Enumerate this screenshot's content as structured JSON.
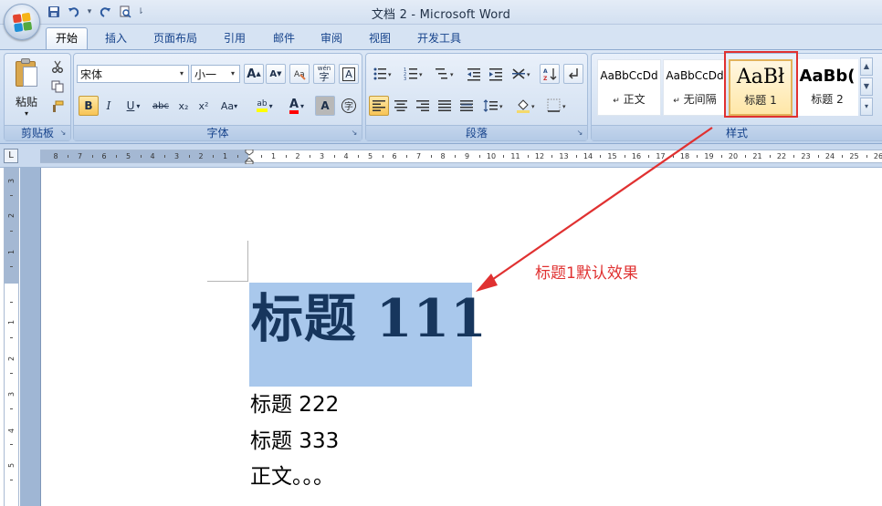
{
  "window": {
    "title": "文档 2 - Microsoft Word"
  },
  "quick_access": {
    "items": [
      "save-icon",
      "undo-icon",
      "redo-icon",
      "print-preview-icon",
      "customize-icon"
    ]
  },
  "tabs": [
    {
      "label": "开始",
      "active": true
    },
    {
      "label": "插入"
    },
    {
      "label": "页面布局"
    },
    {
      "label": "引用"
    },
    {
      "label": "邮件"
    },
    {
      "label": "审阅"
    },
    {
      "label": "视图"
    },
    {
      "label": "开发工具"
    }
  ],
  "ribbon": {
    "clipboard": {
      "label": "剪贴板",
      "paste_label": "粘贴"
    },
    "font": {
      "label": "字体",
      "font_name": "宋体",
      "font_size": "小一",
      "grow": "A",
      "shrink": "A",
      "bold": "B",
      "italic": "I",
      "underline": "U",
      "strike": "abc",
      "subscript": "x₂",
      "superscript": "x²",
      "case": "Aa",
      "highlight": "ab",
      "font_color": "A",
      "char_shade": "A",
      "enclose": "字",
      "wen": "wén",
      "char_border": "A"
    },
    "paragraph": {
      "label": "段落"
    },
    "styles": {
      "label": "样式",
      "items": [
        {
          "sample": "AaBbCcDd",
          "name": "正文",
          "mark": "↵"
        },
        {
          "sample": "AaBbCcDd",
          "name": "无间隔",
          "mark": "↵"
        },
        {
          "sample": "AaBł",
          "name": "标题 1",
          "selected": true
        },
        {
          "sample": "AaBb(",
          "name": "标题 2"
        }
      ]
    }
  },
  "ruler": {
    "numbers_left": [
      "8",
      "7",
      "6",
      "5",
      "4",
      "3",
      "2",
      "1"
    ],
    "numbers_right": [
      "1",
      "2",
      "3",
      "4",
      "5",
      "6",
      "7",
      "8",
      "9",
      "10",
      "11",
      "12",
      "13",
      "14",
      "15",
      "16",
      "17",
      "18",
      "19",
      "20",
      "21",
      "22",
      "23",
      "24",
      "25",
      "26"
    ],
    "vertical_numbers": [
      "3",
      "2",
      "1",
      "1",
      "2",
      "3",
      "4",
      "5"
    ]
  },
  "document": {
    "heading1": "标题 111",
    "line2": "标题 222",
    "line3": "标题 333",
    "line4": "正文。。。"
  },
  "annotation": {
    "text": "标题1默认效果",
    "color": "#e03131"
  },
  "colors": {
    "accent": "#15428b",
    "heading": "#17365d",
    "selection": "#a9c8ec",
    "annotation_red": "#e03131"
  }
}
